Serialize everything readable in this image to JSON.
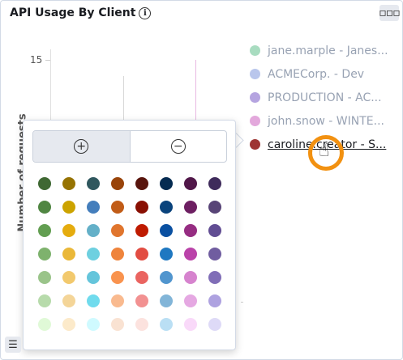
{
  "panel": {
    "title": "API Usage By Client",
    "info_icon": "i",
    "menu_icon": "▫▫▫"
  },
  "chart": {
    "ylabel": "Number of requests",
    "ytick": "15"
  },
  "legend": {
    "items": [
      {
        "label": "jane.marple - Janes...",
        "color": "#a8dcc0"
      },
      {
        "label": "ACMECorp. - Dev",
        "color": "#b9c6ec"
      },
      {
        "label": "PRODUCTION - AC...",
        "color": "#b5a4e0"
      },
      {
        "label": "john.snow - WINTE...",
        "color": "#e3a8dc"
      },
      {
        "label": "caroline.creator - S...",
        "color": "#9e3533"
      }
    ]
  },
  "color_picker": {
    "zoom_in_icon": "+",
    "zoom_out_icon": "−",
    "colors": [
      [
        "#3f6833",
        "#967302",
        "#2f575e",
        "#99440a",
        "#58140c",
        "#052b51",
        "#511749",
        "#3f2b5b"
      ],
      [
        "#508642",
        "#cca300",
        "#447ebc",
        "#c15c17",
        "#890f02",
        "#0a437c",
        "#6d1f62",
        "#584477"
      ],
      [
        "#629e51",
        "#e5ac0e",
        "#64b0c8",
        "#e0752d",
        "#bf1b00",
        "#0a50a1",
        "#962d82",
        "#614d93"
      ],
      [
        "#7eb26d",
        "#eab839",
        "#6ed0e0",
        "#ef843c",
        "#e24d42",
        "#1f78c1",
        "#ba43a9",
        "#705da0"
      ],
      [
        "#9ac48a",
        "#f2c96d",
        "#65c5db",
        "#f9934e",
        "#ea6460",
        "#5195ce",
        "#d683ce",
        "#806eb7"
      ],
      [
        "#b7dbab",
        "#f4d598",
        "#70dbed",
        "#f9ba8f",
        "#f29191",
        "#82b5d8",
        "#e5a8e2",
        "#aea2e0"
      ],
      [
        "#e0f9d7",
        "#fceaca",
        "#cffaff",
        "#f9e2d2",
        "#fce2de",
        "#badff4",
        "#f9d9f9",
        "#dedaf7"
      ]
    ]
  },
  "corner": {
    "list_icon": "☰"
  }
}
